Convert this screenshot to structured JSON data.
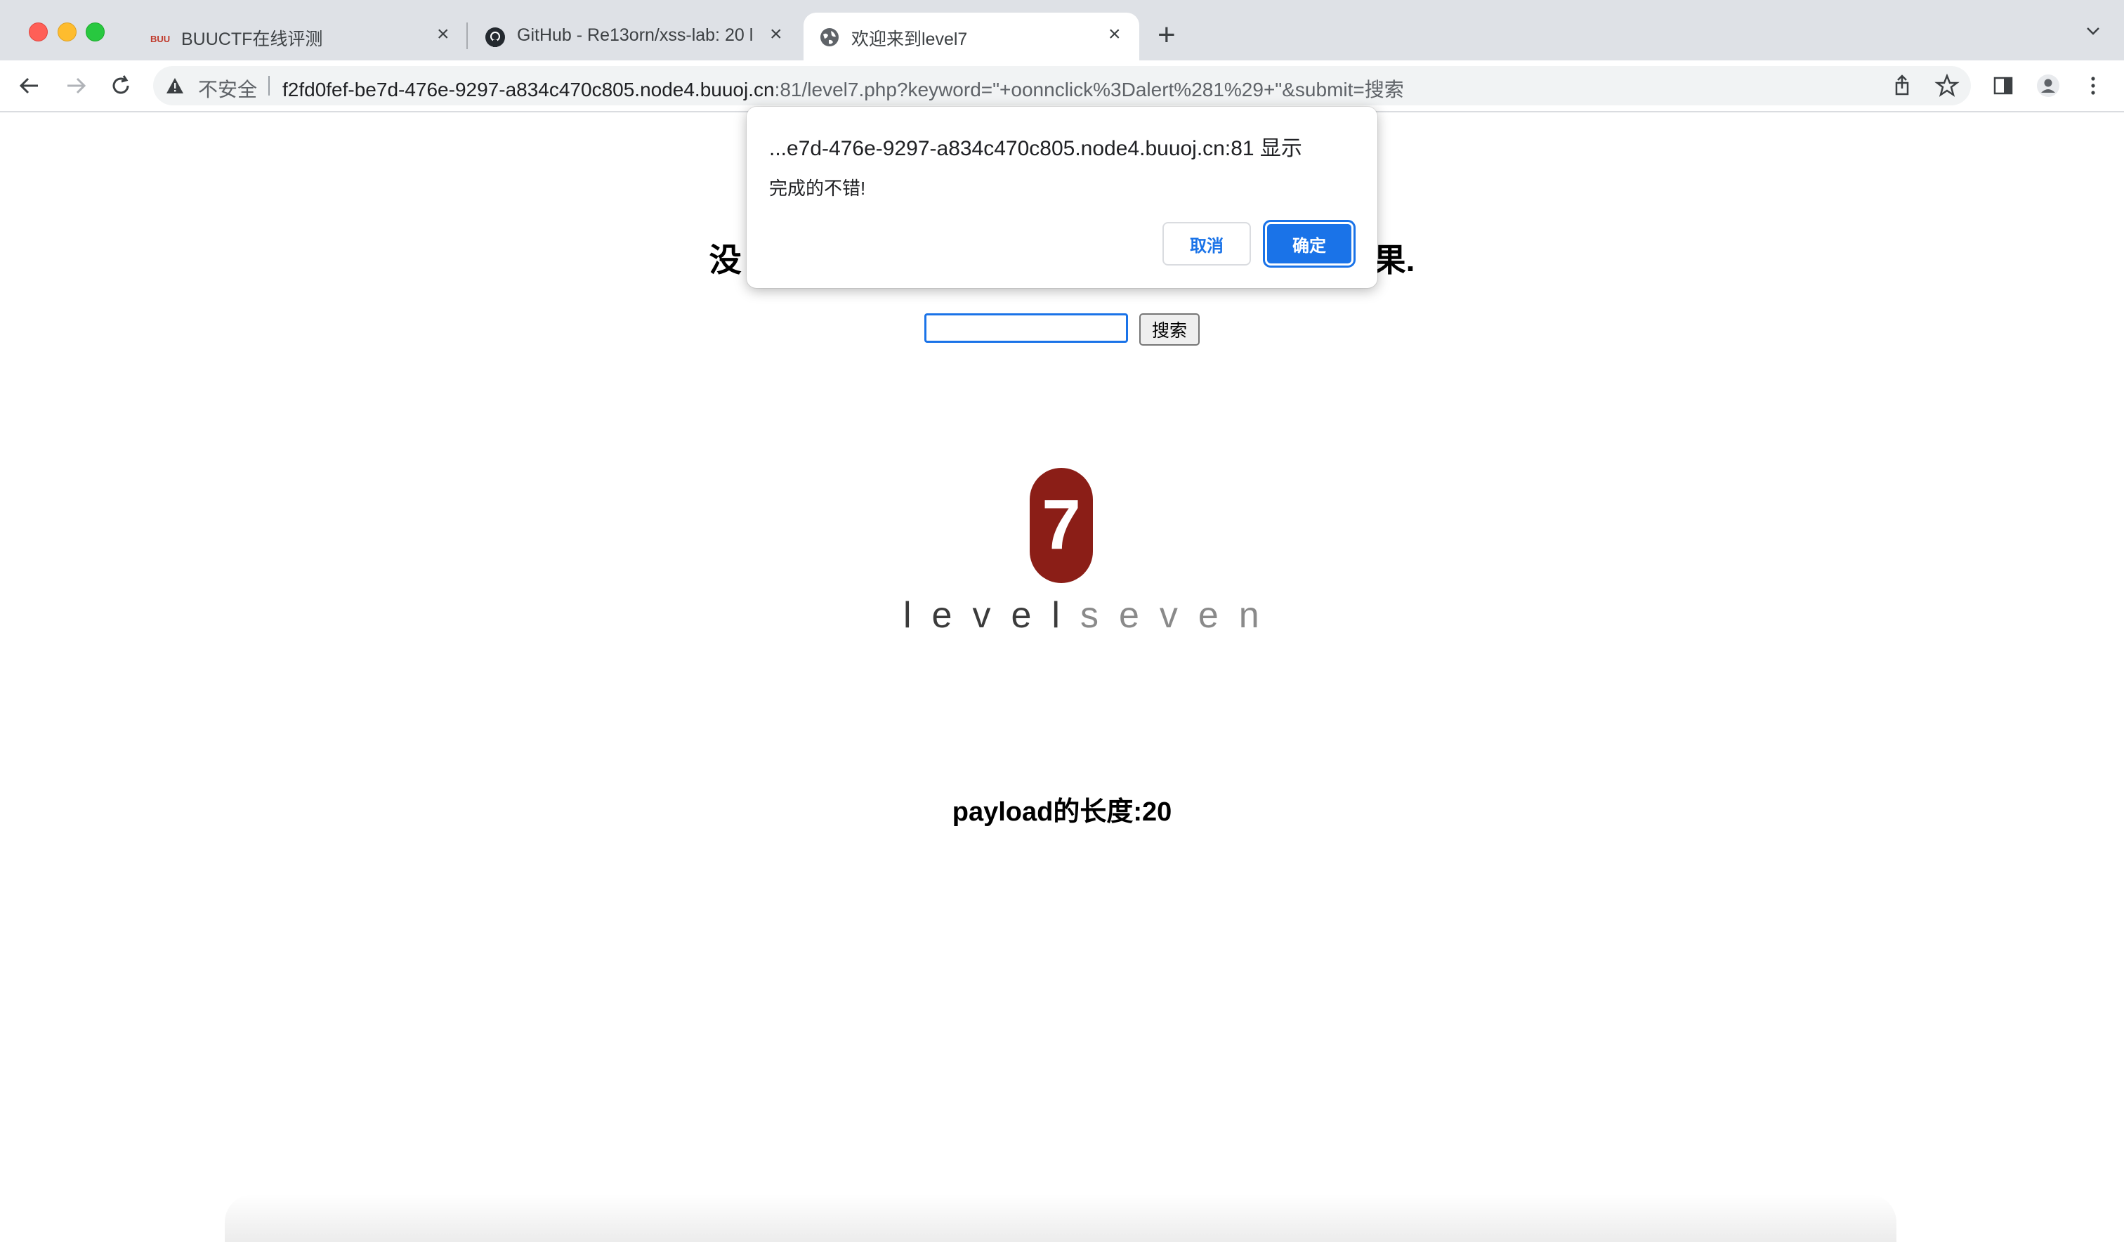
{
  "browser": {
    "tabs": [
      {
        "title": "BUUCTF在线评测",
        "icon": "buuctf-favicon"
      },
      {
        "title": "GitHub - Re13orn/xss-lab: 20 l",
        "icon": "github-icon"
      },
      {
        "title": "欢迎来到level7",
        "icon": "globe-icon"
      }
    ],
    "security_label": "不安全",
    "url_host": "f2fd0fef-be7d-476e-9297-a834c470c805.node4.buuoj.cn",
    "url_path": ":81/level7.php?keyword=\"+oonnclick%3Dalert%281%29+\"&submit=搜索"
  },
  "page": {
    "heading_left": "没",
    "heading_right": "果.",
    "search_value": "",
    "search_button": "搜索",
    "logo_number": "7",
    "logo_word_dark": "level",
    "logo_word_light": "seven",
    "payload_length": "payload的长度:20"
  },
  "dialog": {
    "title": "...e7d-476e-9297-a834c470c805.node4.buuoj.cn:81 显示",
    "message": "完成的不错!",
    "cancel_label": "取消",
    "ok_label": "确定"
  },
  "colors": {
    "accent": "#1a73e8",
    "logo_red": "#8b1e17",
    "tabstrip": "#dee1e6"
  }
}
